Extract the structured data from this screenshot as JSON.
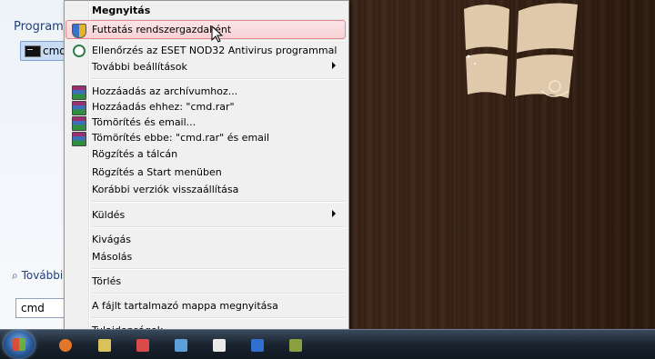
{
  "start_menu": {
    "programs_label": "Programo",
    "result_item": "cmd",
    "more_results": "További",
    "search_value": "cmd"
  },
  "context_menu": {
    "items": [
      {
        "label": "Megnyitás",
        "bold": true,
        "icon": "none"
      },
      {
        "label": "Futtatás rendszergazdaként",
        "highlighted": true,
        "icon": "uac-shield-icon"
      },
      {
        "label": "Ellenőrzés az ESET NOD32 Antivirus programmal",
        "icon": "eset-icon"
      },
      {
        "label": "További beállítások",
        "submenu": true
      },
      {
        "label": "Hozzáadás az archívumhoz...",
        "icon": "winrar-icon"
      },
      {
        "label": "Hozzáadás ehhez: \"cmd.rar\"",
        "icon": "winrar-icon"
      },
      {
        "label": "Tömörítés és email...",
        "icon": "winrar-icon"
      },
      {
        "label": "Tömörítés ebbe: \"cmd.rar\" és email",
        "icon": "winrar-icon"
      },
      {
        "label": "Rögzítés a tálcán"
      },
      {
        "label": "Rögzítés a Start menüben"
      },
      {
        "label": "Korábbi verziók visszaállítása"
      },
      {
        "label": "Küldés",
        "submenu": true
      },
      {
        "label": "Kivágás"
      },
      {
        "label": "Másolás"
      },
      {
        "label": "Törlés"
      },
      {
        "label": "A fájlt tartalmazó mappa megnyitása"
      },
      {
        "label": "Tulajdonságok"
      }
    ]
  },
  "colors": {
    "highlight": "#f7d2d5",
    "menu_bg": "#f0f0f0",
    "link": "#1e3f7a"
  }
}
